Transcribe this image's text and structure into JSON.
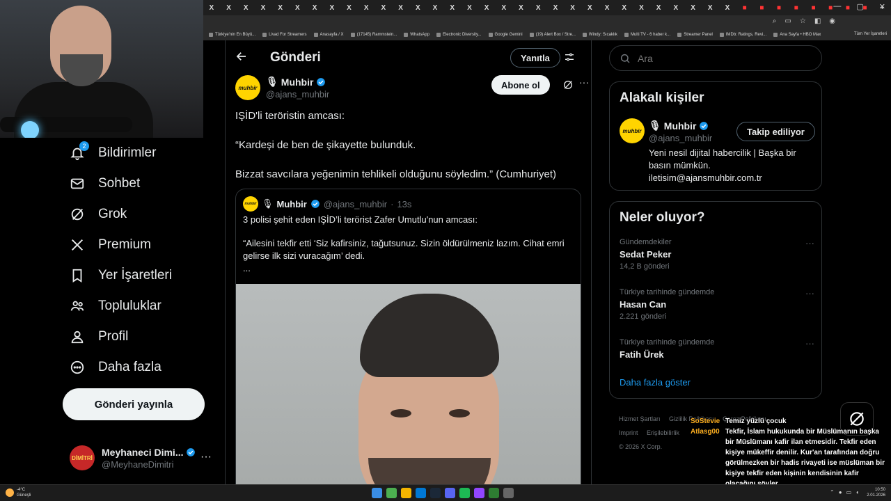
{
  "browser": {
    "tabs": [
      "X",
      "X",
      "X",
      "X",
      "X",
      "X",
      "X",
      "X",
      "X",
      "X",
      "X",
      "X",
      "X",
      "X",
      "X",
      "X",
      "X",
      "X",
      "X",
      "X",
      "X",
      "X",
      "X",
      "X",
      "X",
      "X",
      "X",
      "X",
      "X",
      "X",
      "X",
      "",
      "",
      "",
      "",
      "",
      "",
      "",
      ""
    ],
    "window_controls": [
      "—",
      "▢",
      "✕"
    ],
    "new_tab": "+",
    "bookmarks": [
      "Türkiye'nin En Büyü...",
      "Livad For Streamers",
      "Anasayfa / X",
      "(17145) Rammstein...",
      "WhatsApp",
      "Electronic Diversity...",
      "Google Gemini",
      "(19) Alert Box / Stre...",
      "Windy: Sıcaklık",
      "Multi TV - 6 haber k...",
      "Streamer Panel",
      "IMDb: Ratings, Revi...",
      "Ana Sayfa • HBO Max"
    ],
    "bookmarks_all": "Tüm Yer İşaretleri"
  },
  "nav": {
    "items": [
      {
        "label": "Bildirimler",
        "icon": "bell-icon",
        "badge": "2"
      },
      {
        "label": "Sohbet",
        "icon": "mail-icon"
      },
      {
        "label": "Grok",
        "icon": "grok-icon"
      },
      {
        "label": "Premium",
        "icon": "x-logo-icon"
      },
      {
        "label": "Yer İşaretleri",
        "icon": "bookmark-icon"
      },
      {
        "label": "Topluluklar",
        "icon": "communities-icon"
      },
      {
        "label": "Profil",
        "icon": "profile-icon"
      },
      {
        "label": "Daha fazla",
        "icon": "more-circle-icon"
      }
    ],
    "post_button": "Gönderi yayınla",
    "account": {
      "name": "Meyhaneci Dimi...",
      "handle": "@MeyhaneDimitri",
      "avatar_text": "DİMİTRİ",
      "more": "···"
    }
  },
  "main": {
    "title": "Gönderi",
    "reply_button": "Yanıtla",
    "author": {
      "name": "Muhbir",
      "handle": "@ajans_muhbir",
      "avatar_text": "muhbir",
      "subscribe_button": "Abone ol"
    },
    "tweet_paragraphs": [
      "IŞİD'li teröristin amcası:",
      "“Kardeşi de ben de şikayette bulunduk.",
      "Bizzat savcılara yeğenimin tehlikeli olduğunu söyledim.” (Cumhuriyet)"
    ],
    "quote": {
      "name": "Muhbir",
      "handle": "@ajans_muhbir",
      "separator": "·",
      "time": "13s",
      "lines": [
        "3 polisi şehit eden IŞİD’li terörist Zafer Umutlu'nun amcası:",
        "“Ailesini tekfir etti ‘Siz kafirsiniz, tağutsunuz. Sizin öldürülmeniz lazım. Cihat emri gelirse ilk sizi vuracağım’ dedi.",
        "..."
      ]
    }
  },
  "right": {
    "search_placeholder": "Ara",
    "related": {
      "title": "Alakalı kişiler",
      "name": "Muhbir",
      "handle": "@ajans_muhbir",
      "follow_button": "Takip ediliyor",
      "bio": "Yeni nesil dijital habercilik | Başka bir basın mümkün. iletisim@ajansmuhbir.com.tr"
    },
    "trends": {
      "title": "Neler oluyor?",
      "items": [
        {
          "context": "Gündemdekiler",
          "name": "Sedat Peker",
          "count": "14,2 B gönderi"
        },
        {
          "context": "Türkiye tarihinde gündemde",
          "name": "Hasan Can",
          "count": "2.221 gönderi"
        },
        {
          "context": "Türkiye tarihinde gündemde",
          "name": "Fatih Ürek",
          "count": ""
        }
      ],
      "show_more": "Daha fazla göster"
    },
    "footer": {
      "links": [
        "Hizmet Şartları",
        "Gizlilik Politikası",
        "Çerez Politikası",
        "Imprint",
        "Erişilebilirlik"
      ],
      "copyright": "© 2026 X Corp."
    }
  },
  "chat": [
    {
      "user": "SoStevie",
      "message": "Temiz yüzlü çocuk"
    },
    {
      "user": "Atlasg00",
      "message": "Tekfir, İslam hukukunda bir Müslümanın başka bir Müslümanı kafir ilan etmesidir. Tekfir eden kişiye mükeffir denilir. Kur'an tarafından doğru görülmezken bir hadis rivayeti ise müslüman bir kişiye tekfir eden kişinin kendisinin kafir olacağını söyler."
    }
  ],
  "taskbar": {
    "weather_temp": "-4°C",
    "weather_desc": "Güneşli",
    "time": "10:50",
    "date": "2.01.2026"
  },
  "colors": {
    "accent": "#1d9bf0",
    "brand_muhbir": "#ffd400",
    "border": "#2f3336",
    "muted": "#71767b",
    "chat_user": "#ffb020"
  }
}
